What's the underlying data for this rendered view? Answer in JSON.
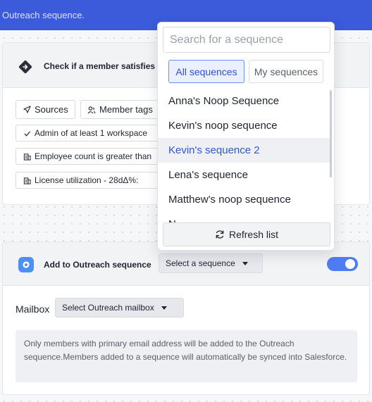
{
  "header": {
    "text": "Outreach sequence."
  },
  "condition_card": {
    "title": "Check if a member satisfies",
    "chips": {
      "sources": "Sources",
      "member_tags": "Member tags",
      "admin": "Admin of at least 1 workspace",
      "employee_count": "Employee count is greater than",
      "license": "License utilization - 28dΔ%: "
    }
  },
  "action_card": {
    "title": "Add to Outreach sequence",
    "select_sequence": "Select a sequence",
    "mailbox_label": "Mailbox",
    "select_mailbox": "Select Outreach mailbox",
    "toggle_on": true,
    "notice": "Only members with primary email address will be added to the Outreach sequence.Members added to a sequence will automatically be synced into Salesforce."
  },
  "dropdown": {
    "search_placeholder": "Search for a sequence",
    "tabs": {
      "all": "All sequences",
      "mine": "My sequences"
    },
    "items": [
      {
        "label": "Anna's Noop Sequence"
      },
      {
        "label": "Kevin's noop sequence"
      },
      {
        "label": "Kevin's sequence 2"
      },
      {
        "label": "Lena's sequence"
      },
      {
        "label": "Matthew's noop sequence"
      },
      {
        "label": "N"
      }
    ],
    "selected_index": 2,
    "refresh_label": "Refresh list"
  },
  "colors": {
    "header": "#3b5bdb",
    "accent": "#4d7cf5",
    "selected_text": "#3456c9"
  },
  "icons": {
    "condition": "diamond-arrow-icon",
    "outreach": "outreach-logo-icon",
    "sources": "send-icon",
    "member_tags": "users-icon",
    "admin": "check-icon",
    "employee": "building-icon",
    "license": "building-icon",
    "refresh": "refresh-icon"
  }
}
